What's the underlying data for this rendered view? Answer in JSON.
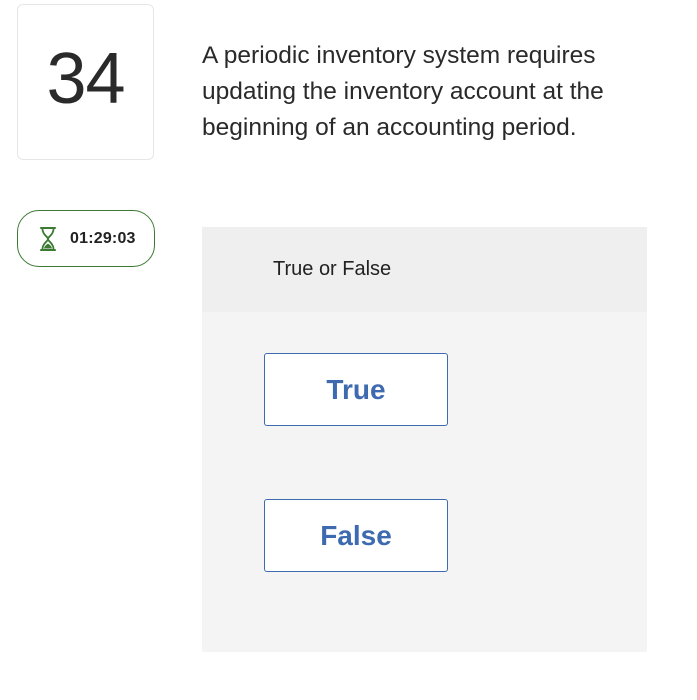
{
  "question": {
    "number": "34",
    "text": "A periodic inventory system requires updating the inventory account at the beginning of an accounting period."
  },
  "timer": {
    "icon": "hourglass-icon",
    "value": "01:29:03",
    "color": "#3d7a34"
  },
  "answer_panel": {
    "header": "True or False",
    "choices": [
      {
        "label": "True"
      },
      {
        "label": "False"
      }
    ],
    "accent_color": "#3e6ab0"
  }
}
